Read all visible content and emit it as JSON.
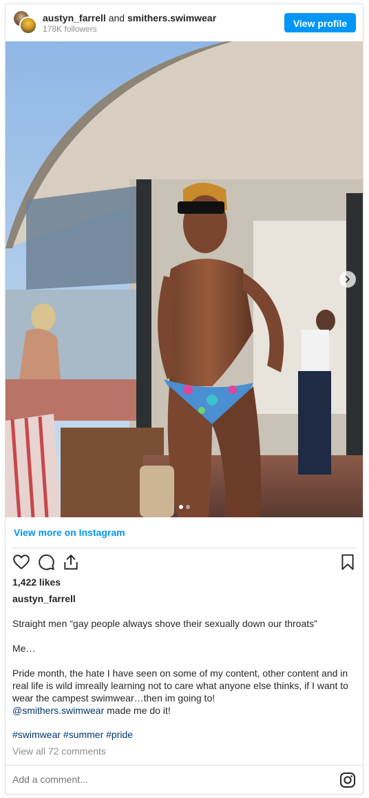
{
  "header": {
    "user1": "austyn_farrell",
    "conjunction": " and ",
    "user2": "smithers.swimwear",
    "followers": "178K followers",
    "view_profile": "View profile"
  },
  "photo": {
    "slide_count": 2,
    "active_slide": 1
  },
  "view_more": "View more on Instagram",
  "likes": "1,422 likes",
  "author": "austyn_farrell",
  "caption": {
    "line1": "Straight men “gay people always shove their sexually down our throats”",
    "line2": "Me…",
    "line3": "Pride month, the hate I have seen on some of my content, other content and in real life is wild imreally learning not to care what anyone else thinks, if I want to wear the campest swimwear…then im going to!",
    "mention": "@smithers.swimwear",
    "after_mention": " made me do it!"
  },
  "hashtags": "#swimwear #summer #pride",
  "view_comments": "View all 72 comments",
  "comment_placeholder": "Add a comment...",
  "colors": {
    "accent": "#0095f6",
    "link": "#00376b",
    "muted": "#8e8e8e",
    "border": "#dbdbdb"
  },
  "icons": [
    "heart-icon",
    "comment-icon",
    "share-icon",
    "bookmark-icon",
    "instagram-icon",
    "chevron-right-icon"
  ]
}
